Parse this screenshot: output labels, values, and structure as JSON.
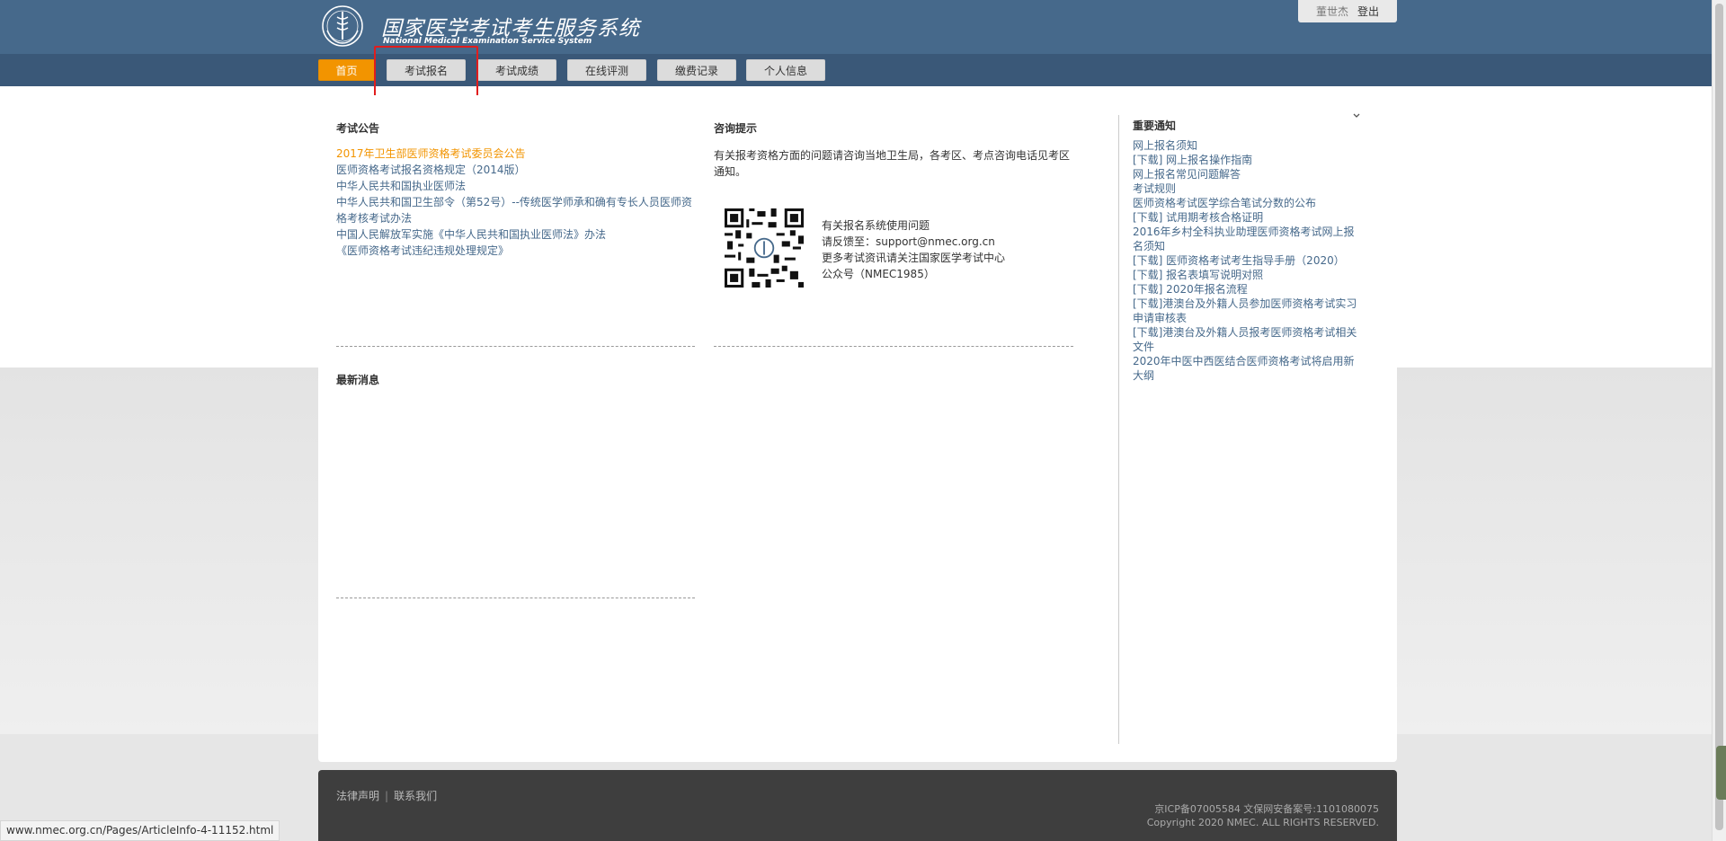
{
  "header": {
    "title": "国家医学考试考生服务系统",
    "subtitle": "National Medical Examination Service System",
    "colors": {
      "header_bg": "#46698b",
      "nav_bg": "#3a5878",
      "accent": "#f29400",
      "highlight": "#e11d1d"
    }
  },
  "user": {
    "name": "董世杰",
    "logout_label": "登出"
  },
  "nav": {
    "items": [
      {
        "label": "首页",
        "active": true
      },
      {
        "label": "考试报名"
      },
      {
        "label": "考试成绩"
      },
      {
        "label": "在线评测"
      },
      {
        "label": "缴费记录"
      },
      {
        "label": "个人信息"
      }
    ]
  },
  "announcements": {
    "title": "考试公告",
    "items": [
      "2017年卫生部医师资格考试委员会公告",
      "医师资格考试报名资格规定（2014版）",
      "中华人民共和国执业医师法",
      "中华人民共和国卫生部令（第52号）--传统医学师承和确有专长人员医师资格考核考试办法",
      "中国人民解放军实施《中华人民共和国执业医师法》办法",
      "《医师资格考试违纪违规处理规定》"
    ]
  },
  "news": {
    "title": "最新消息"
  },
  "consult": {
    "title": "咨询提示",
    "text": "有关报考资格方面的问题请咨询当地卫生局，各考区、考点咨询电话见考区通知。",
    "lines": [
      "有关报名系统使用问题",
      "请反馈至：support@nmec.org.cn",
      "更多考试资讯请关注国家医学考试中心",
      "公众号（NMEC1985）"
    ]
  },
  "notices": {
    "title": "重要通知",
    "items": [
      "网上报名须知",
      "[下载] 网上报名操作指南",
      "网上报名常见问题解答",
      "考试规则",
      "医师资格考试医学综合笔试分数的公布",
      "[下载] 试用期考核合格证明",
      "2016年乡村全科执业助理医师资格考试网上报名须知",
      "[下载] 医师资格考试考生指导手册（2020）",
      "[下载] 报名表填写说明对照",
      "[下载] 2020年报名流程",
      "[下载]港澳台及外籍人员参加医师资格考试实习申请审核表",
      "[下载]港澳台及外籍人员报考医师资格考试相关文件",
      "2020年中医中西医结合医师资格考试将启用新大纲"
    ]
  },
  "footer": {
    "legal": "法律声明",
    "contact": "联系我们",
    "separator": "|",
    "icp": "京ICP备07005584 文保网安备案号:1101080075",
    "copyright": "Copyright 2020 NMEC. ALL RIGHTS RESERVED."
  },
  "statusbar": {
    "url": "www.nmec.org.cn/Pages/ArticleInfo-4-11152.html"
  }
}
